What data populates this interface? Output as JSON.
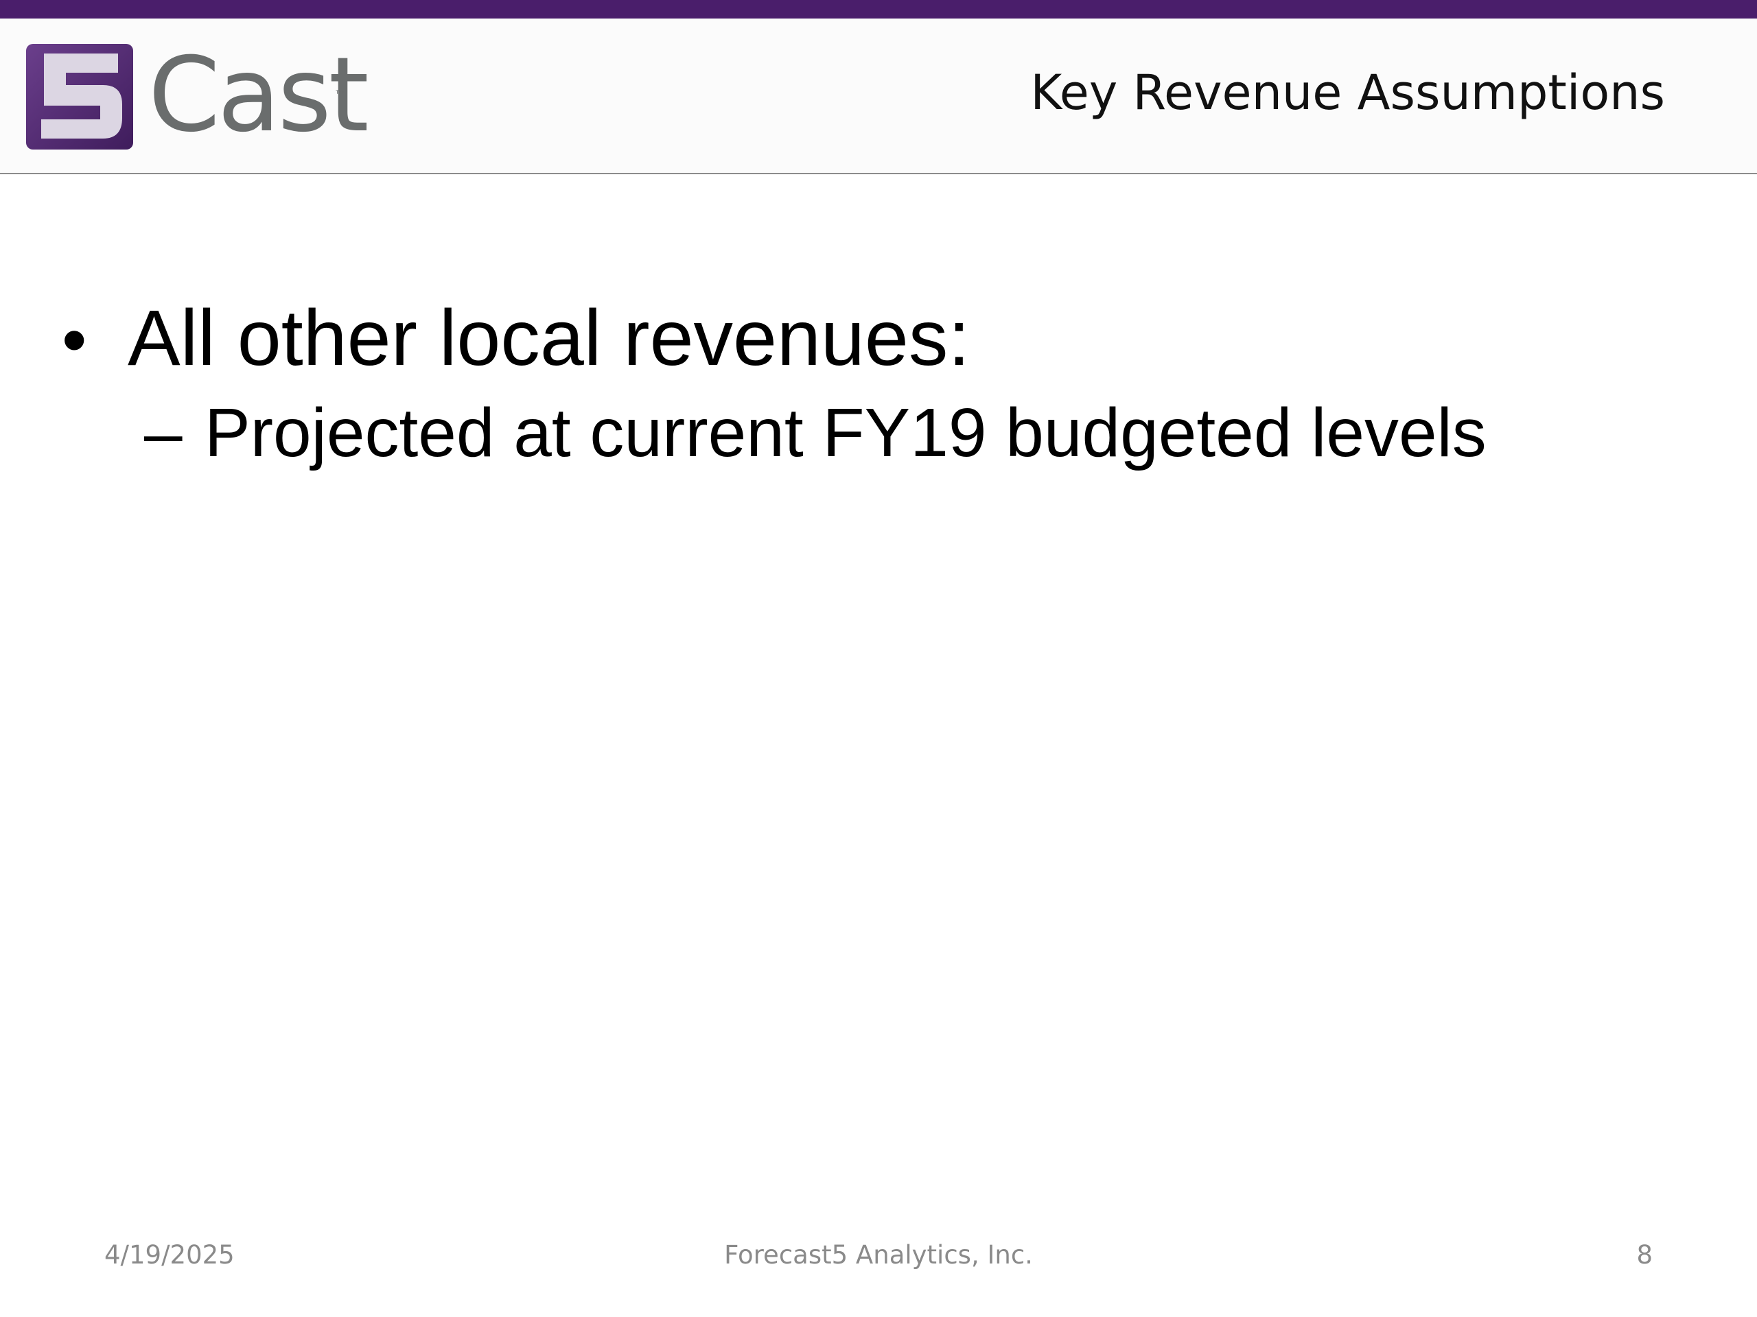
{
  "brand": {
    "logo_text": "Cast",
    "logo_mark_numeral": "5",
    "trademark": "™",
    "colors": {
      "accent_bar": "#4a1e6b",
      "logo_purple": "#4f2a6f",
      "logo_gray": "#6a6d6d"
    }
  },
  "slide": {
    "title": "Key Revenue Assumptions",
    "bullets": [
      {
        "text": "All other local revenues:",
        "sub_items": [
          {
            "text": "Projected at current FY19 budgeted levels"
          }
        ]
      }
    ]
  },
  "footer": {
    "date": "4/19/2025",
    "company": "Forecast5 Analytics, Inc.",
    "page_number": "8"
  }
}
